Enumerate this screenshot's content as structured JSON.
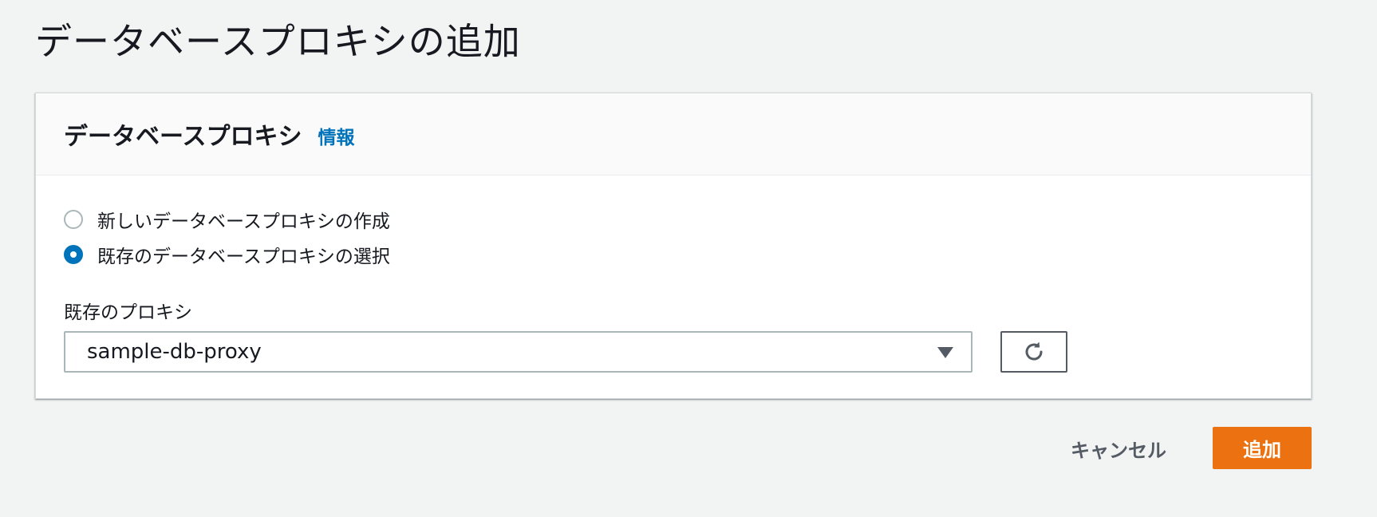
{
  "page": {
    "title": "データベースプロキシの追加"
  },
  "panel": {
    "title": "データベースプロキシ",
    "info_link": "情報",
    "options": [
      {
        "label": "新しいデータベースプロキシの作成",
        "selected": false
      },
      {
        "label": "既存のデータベースプロキシの選択",
        "selected": true
      }
    ],
    "existing_proxy": {
      "label": "既存のプロキシ",
      "selected_value": "sample-db-proxy"
    }
  },
  "footer": {
    "cancel_label": "キャンセル",
    "add_label": "追加"
  },
  "icons": {
    "dropdown": "caret-down-icon",
    "refresh": "refresh-icon"
  },
  "colors": {
    "accent": "#0073bb",
    "primary_button": "#ec7211",
    "background": "#f2f3f3"
  }
}
